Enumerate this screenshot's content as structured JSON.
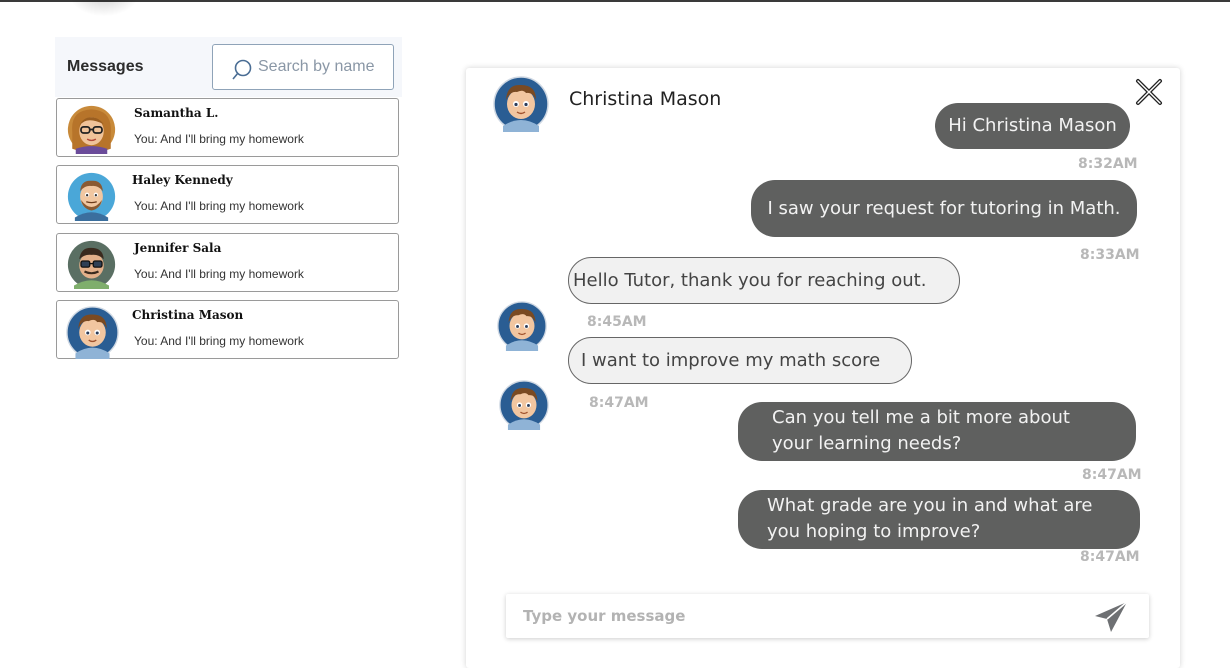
{
  "sidebar": {
    "title": "Messages",
    "search_placeholder": "Search by name",
    "conversations": [
      {
        "name": "Samantha L.",
        "preview": "You: And I'll bring my homework"
      },
      {
        "name": "Haley Kennedy",
        "preview": "You: And I'll bring my homework"
      },
      {
        "name": "Jennifer Sala",
        "preview": "You: And I'll bring my homework"
      },
      {
        "name": "Christina Mason",
        "preview": "You: And I'll bring my homework"
      }
    ]
  },
  "chat": {
    "contact_name": "Christina Mason",
    "messages": [
      {
        "direction": "outgoing",
        "text": "Hi Christina Mason",
        "time": "8:32AM"
      },
      {
        "direction": "outgoing",
        "text": "I saw your request for tutoring in Math.",
        "time": "8:33AM"
      },
      {
        "direction": "incoming",
        "text": "Hello Tutor, thank you for reaching out.",
        "time": "8:45AM"
      },
      {
        "direction": "incoming",
        "text": "I want to improve my math score",
        "time": "8:47AM"
      },
      {
        "direction": "outgoing",
        "text": "Can you tell me a bit more about your learning needs?",
        "time": "8:47AM"
      },
      {
        "direction": "outgoing",
        "text": "What grade are you in and what are you hoping to improve?",
        "time": "8:47AM"
      }
    ],
    "compose_placeholder": "Type your message"
  },
  "icons": {
    "search": "search-icon",
    "close": "close-icon",
    "send": "send-icon"
  },
  "colors": {
    "outgoing_bubble": "#5f605f",
    "incoming_bubble": "#f1f1f1",
    "timestamp": "#b8b8b8"
  }
}
